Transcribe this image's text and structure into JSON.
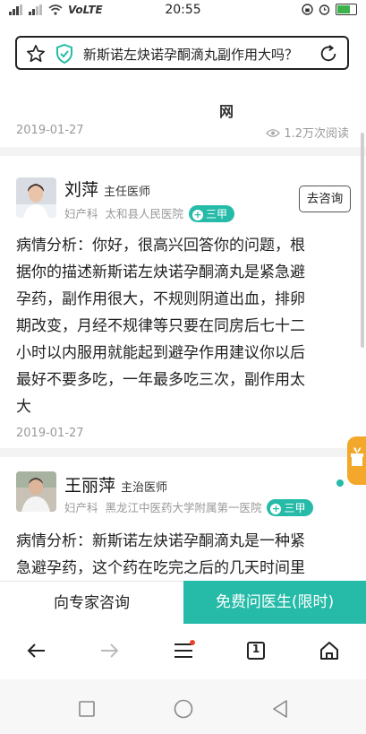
{
  "status_bar": {
    "carrier": "VoLTE",
    "time": "20:55"
  },
  "search": {
    "query": "新斯诺左炔诺孕酮滴丸副作用大吗？"
  },
  "header": {
    "watermark": "网",
    "date": "2019-01-27",
    "views": "1.2万次阅读"
  },
  "answers": [
    {
      "doctor_name": "刘萍",
      "doctor_title": "主任医师",
      "department": "妇产科",
      "hospital": "太和县人民医院",
      "badge": "三甲",
      "consult_label": "去咨询",
      "lines": [
        "病情分析：你好，很高兴回答你的问题，根",
        "据你的描述新斯诺左炔诺孕酮滴丸是紧急避",
        "孕药，副作用很大，不规则阴道出血，排卵",
        "期改变，月经不规律等只要在同房后七十二",
        "小时以内服用就能起到避孕作用建议你以后",
        "最好不要多吃，一年最多吃三次，副作用太",
        "大"
      ],
      "date": "2019-01-27"
    },
    {
      "doctor_name": "王丽萍",
      "doctor_title": "主治医师",
      "department": "妇产科",
      "hospital": "黑龙江中医药大学附属第一医院",
      "badge": "三甲",
      "lines": [
        "病情分析：新斯诺左炔诺孕酮滴丸是一种紧",
        "急避孕药，这个药在吃完之后的几天时间里"
      ]
    }
  ],
  "action_bar": {
    "expert_label": "向专家咨询",
    "free_label": "免费问医生(限时)"
  },
  "toolbar": {
    "tab_count": "1"
  },
  "colors": {
    "accent": "#26bba8",
    "float_tab": "#f4a82b",
    "menu_dot": "#e8442b"
  },
  "icons": [
    "back-arrow-icon",
    "forward-arrow-icon",
    "menu-icon",
    "tabs-icon",
    "home-icon",
    "star-icon",
    "shield-check-icon",
    "refresh-icon",
    "square-nav-icon",
    "circle-nav-icon",
    "triangle-back-nav-icon"
  ]
}
